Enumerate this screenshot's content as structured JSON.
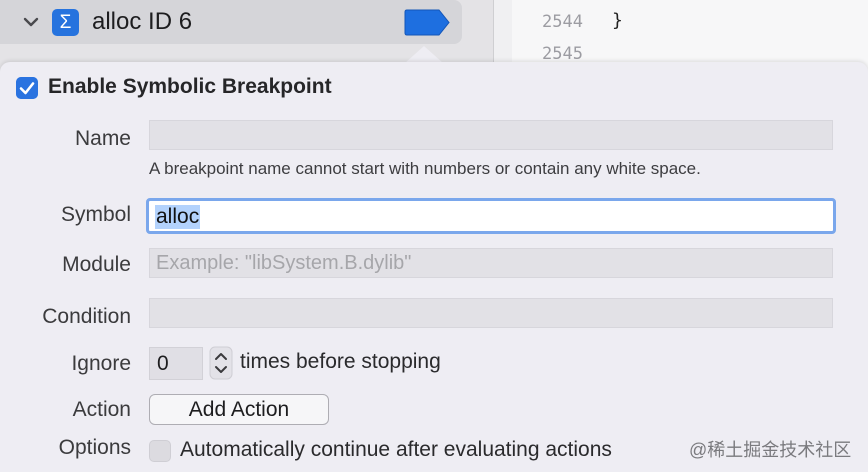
{
  "navigator": {
    "breakpoint": {
      "title": "alloc ID 6",
      "sigma_symbol": "Σ",
      "icon_color": "#2673de"
    }
  },
  "editor": {
    "lines": [
      {
        "number": "2544",
        "code": "}"
      },
      {
        "number": "2545",
        "code": ""
      }
    ]
  },
  "popover": {
    "enable_label": "Enable Symbolic Breakpoint",
    "enabled": true,
    "name": {
      "label": "Name",
      "value": "",
      "hint": "A breakpoint name cannot start with numbers or contain any white space."
    },
    "symbol": {
      "label": "Symbol",
      "value": "alloc"
    },
    "module": {
      "label": "Module",
      "value": "",
      "placeholder": "Example: \"libSystem.B.dylib\""
    },
    "condition": {
      "label": "Condition",
      "value": ""
    },
    "ignore": {
      "label": "Ignore",
      "value": "0",
      "suffix": "times before stopping"
    },
    "action": {
      "label": "Action",
      "button_label": "Add Action"
    },
    "options": {
      "label": "Options",
      "checkbox_label": "Automatically continue after evaluating actions",
      "checked": false
    }
  },
  "watermark": "@稀土掘金技术社区",
  "colors": {
    "accent": "#2a73e0",
    "focus_ring": "#7aa7ec",
    "selection": "#b3d2fc"
  }
}
